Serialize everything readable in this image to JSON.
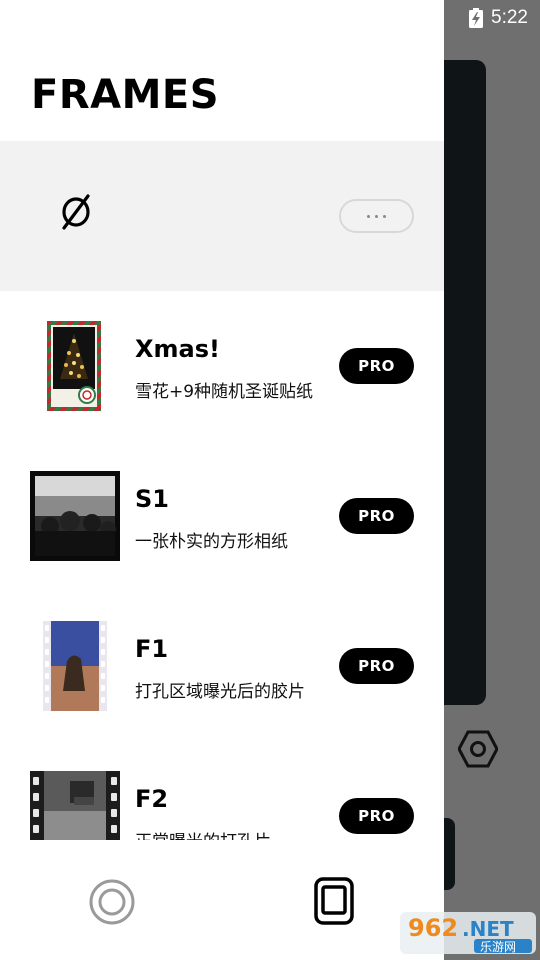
{
  "status_bar": {
    "time": "5:22",
    "battery_icon": "battery-charging-icon"
  },
  "drawer": {
    "title": "FRAMES",
    "none_option": {
      "icon": "empty-set-icon",
      "more_icon": "more-horizontal-icon"
    },
    "items": [
      {
        "title": "Xmas!",
        "subtitle": "雪花+9种随机圣诞贴纸",
        "badge": "PRO"
      },
      {
        "title": "S1",
        "subtitle": "一张朴实的方形相纸",
        "badge": "PRO"
      },
      {
        "title": "F1",
        "subtitle": "打孔区域曝光后的胶片",
        "badge": "PRO"
      },
      {
        "title": "F2",
        "subtitle": "正常曝光的打孔片",
        "badge": "PRO"
      }
    ]
  },
  "bottom_nav": {
    "left_icon": "shutter-circle-icon",
    "right_icon": "frame-square-icon"
  },
  "watermark": {
    "text_top": "962",
    "text_suffix": ".NET",
    "text_bottom": "乐游网"
  }
}
